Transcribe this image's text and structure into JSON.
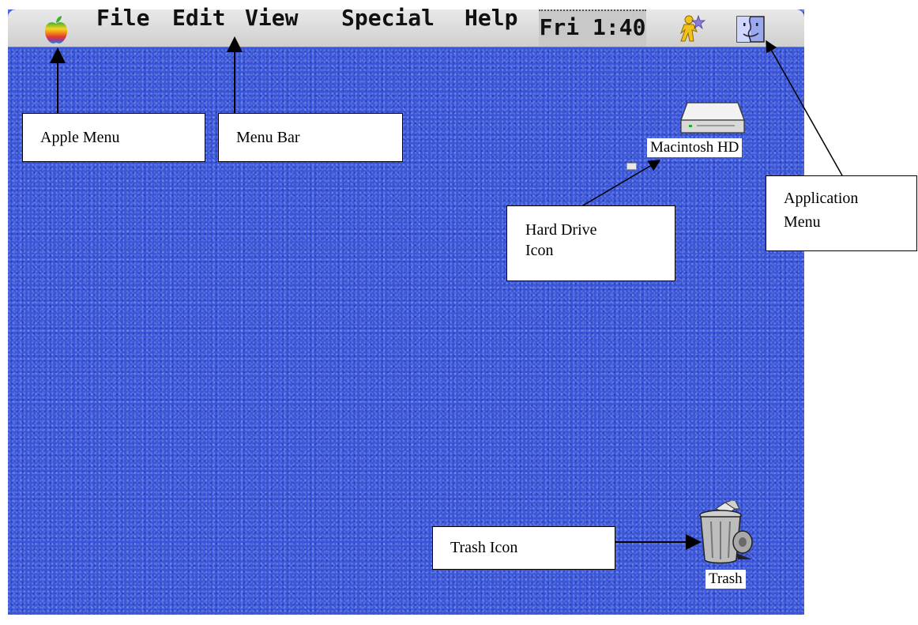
{
  "menubar": {
    "items": [
      {
        "label": "File"
      },
      {
        "label": "Edit"
      },
      {
        "label": "View"
      },
      {
        "label": "Special"
      },
      {
        "label": "Help"
      }
    ],
    "clock": "Fri 1:40",
    "icons": {
      "apple": "apple-menu-icon",
      "person": "user-sharing-icon",
      "finder": "finder-application-icon"
    }
  },
  "desktop": {
    "hard_drive_label": "Macintosh HD",
    "trash_label": "Trash",
    "background_color": "#3a56d8"
  },
  "callouts": {
    "apple_menu": "Apple Menu",
    "menu_bar": "Menu Bar",
    "application_menu_line1": "Application",
    "application_menu_line2": "Menu",
    "hard_drive_line1": "Hard Drive",
    "hard_drive_line2": "Icon",
    "trash": "Trash Icon"
  }
}
